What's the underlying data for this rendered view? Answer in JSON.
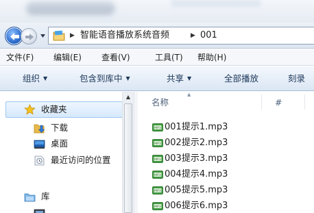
{
  "address_bar": {
    "breadcrumbs": [
      "智能语音播放系统音频",
      "001"
    ]
  },
  "menu": [
    "文件(F)",
    "编辑(E)",
    "查看(V)",
    "工具(T)",
    "帮助(H)"
  ],
  "toolbar": {
    "organize": "组织",
    "include_in_library": "包含到库中",
    "share": "共享",
    "play_all": "全部播放",
    "burn": "刻录"
  },
  "nav": {
    "favorites": "收藏夹",
    "downloads": "下载",
    "desktop": "桌面",
    "recent": "最近访问的位置",
    "libraries": "库"
  },
  "columns": {
    "name": "名称",
    "number": "#"
  },
  "files": [
    "001提示1.mp3",
    "002提示2.mp3",
    "003提示3.mp3",
    "004提示4.mp3",
    "005提示5.mp3",
    "006提示6.mp3"
  ],
  "icons": {
    "back": "back-arrow-icon",
    "forward": "forward-arrow-icon",
    "folder": "folder-icon",
    "star": "star-icon",
    "mp3": "mp3-file-icon"
  },
  "colors": {
    "command_text": "#1e395b",
    "selection_border": "#9cc6f1",
    "back_button": "#2f6fcf"
  }
}
